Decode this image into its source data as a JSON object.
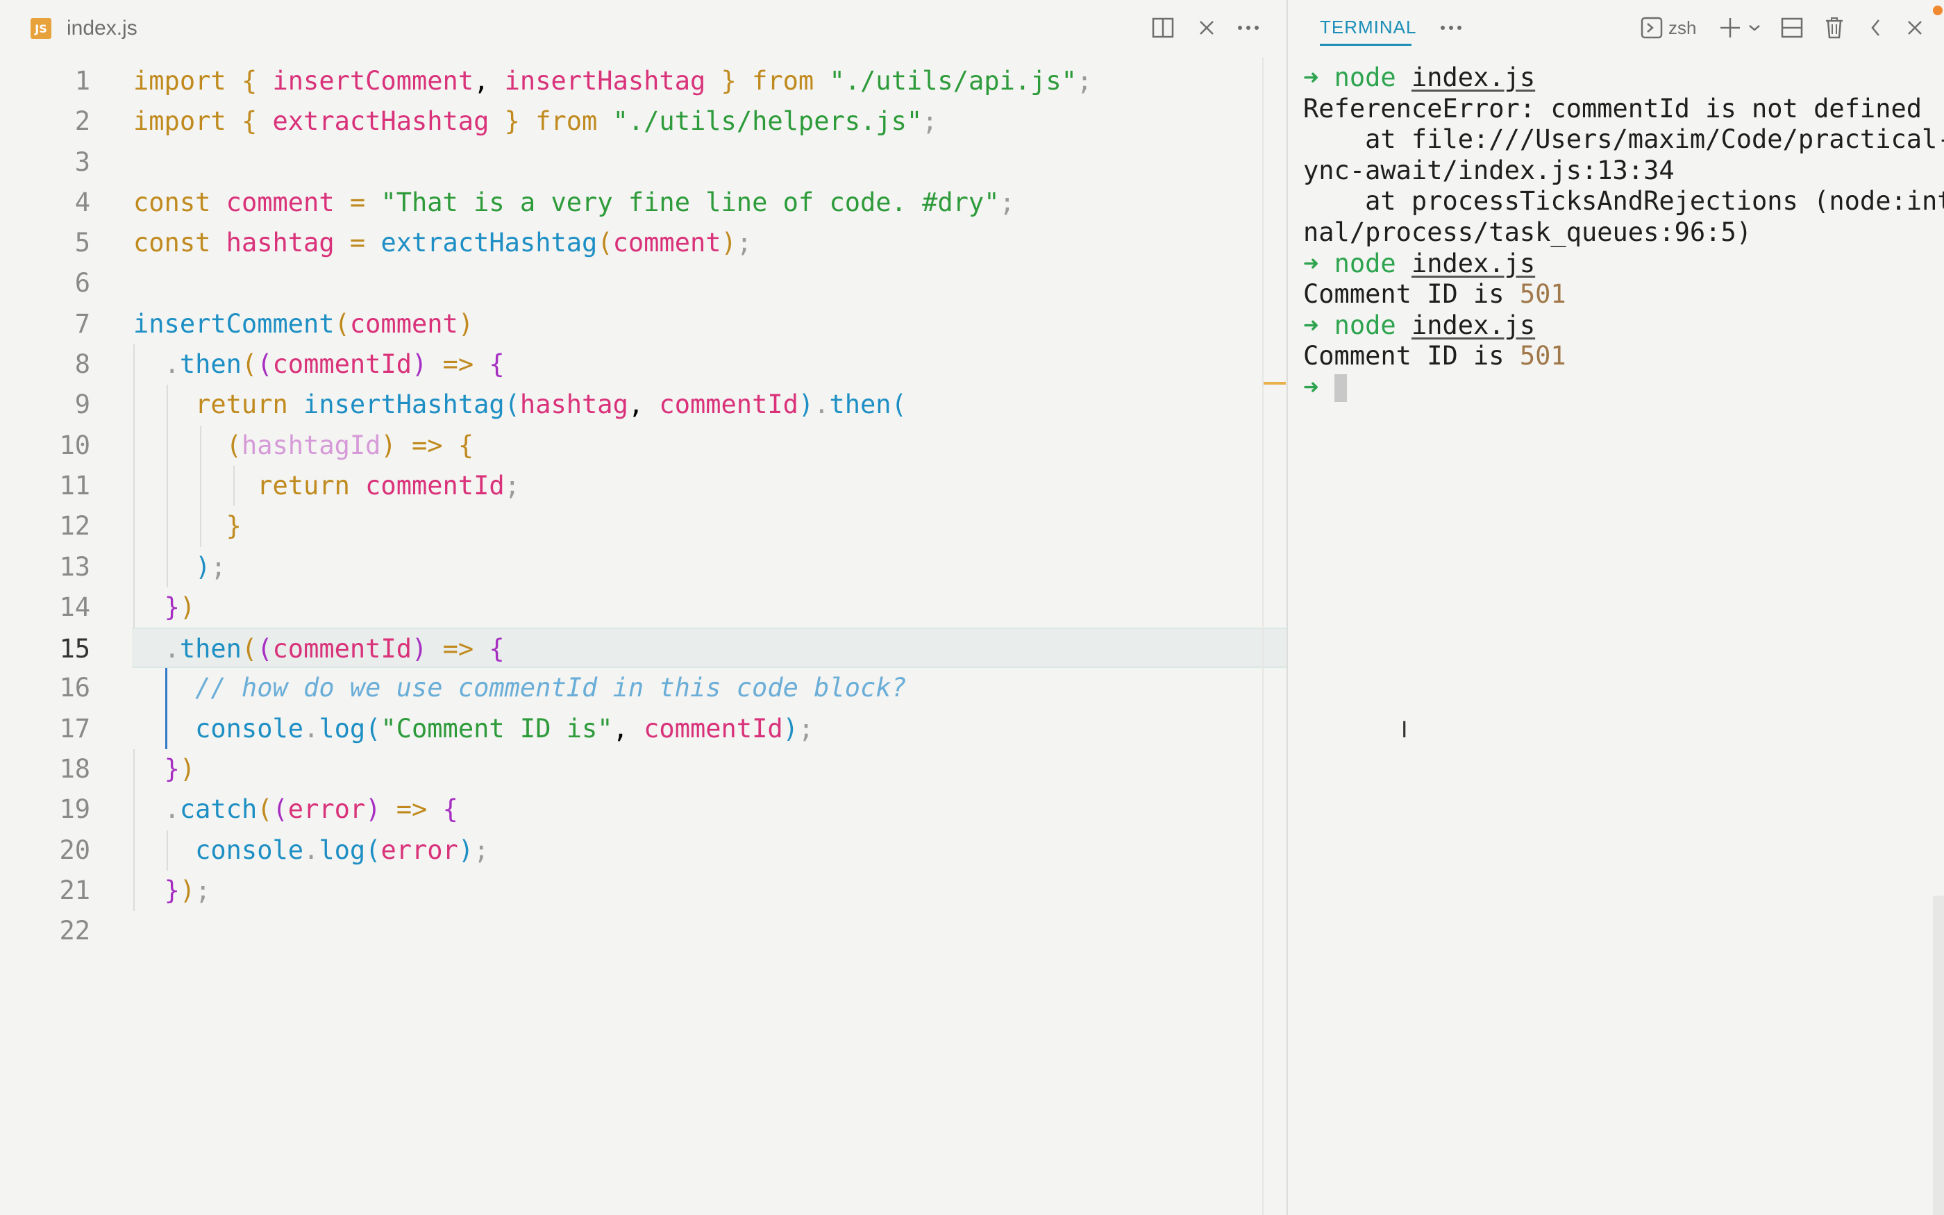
{
  "editor": {
    "file_icon_label": "JS",
    "file_name": "index.js",
    "actions": {
      "split_icon": "split-editor-icon",
      "close_icon": "close-icon",
      "more_icon": "more-icon"
    },
    "lines": [
      {
        "n": "1"
      },
      {
        "n": "2"
      },
      {
        "n": "3"
      },
      {
        "n": "4"
      },
      {
        "n": "5"
      },
      {
        "n": "6"
      },
      {
        "n": "7"
      },
      {
        "n": "8"
      },
      {
        "n": "9"
      },
      {
        "n": "10"
      },
      {
        "n": "11"
      },
      {
        "n": "12"
      },
      {
        "n": "13"
      },
      {
        "n": "14"
      },
      {
        "n": "15"
      },
      {
        "n": "16"
      },
      {
        "n": "17"
      },
      {
        "n": "18"
      },
      {
        "n": "19"
      },
      {
        "n": "20"
      },
      {
        "n": "21"
      },
      {
        "n": "22"
      }
    ],
    "active_line": "15"
  },
  "terminal": {
    "tab_label": "TERMINAL",
    "shell_label": "zsh",
    "prompt_arrow": "➜",
    "command": "node",
    "command_arg": "index.js",
    "error_line": "ReferenceError: commentId is not defined",
    "stack_1a": "    at file:///Users/maxim/Code/practical-as",
    "stack_1b": "ync-await/index.js:13:34",
    "stack_2a": "    at processTicksAndRejections (node:inter",
    "stack_2b": "nal/process/task_queues:96:5)",
    "output_prefix": "Comment ID is ",
    "output_value": "501"
  },
  "colors": {
    "background": "#f4f4f2",
    "accent": "#1c8fb8",
    "prompt_green": "#2ea44f"
  }
}
